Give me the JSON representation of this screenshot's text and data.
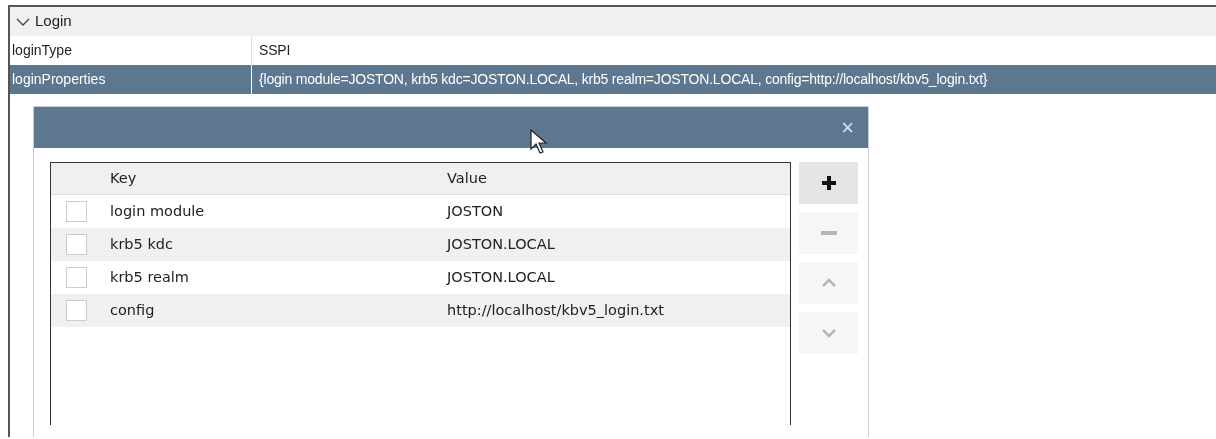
{
  "section": {
    "title": "Login",
    "expanded": true
  },
  "properties": [
    {
      "name": "loginType",
      "value": "SSPI",
      "selected": false
    },
    {
      "name": "loginProperties",
      "value": "{login module=JOSTON, krb5 kdc=JOSTON.LOCAL, krb5 realm=JOSTON.LOCAL, config=http://localhost/kbv5_login.txt}",
      "selected": true
    }
  ],
  "dialog": {
    "close": "×",
    "columns": [
      "Key",
      "Value"
    ],
    "rows": [
      {
        "key": "login module",
        "value": "JOSTON",
        "checked": false
      },
      {
        "key": "krb5 kdc",
        "value": "JOSTON.LOCAL",
        "checked": false
      },
      {
        "key": "krb5 realm",
        "value": "JOSTON.LOCAL",
        "checked": false
      },
      {
        "key": "config",
        "value": "http://localhost/kbv5_login.txt",
        "checked": false
      }
    ],
    "buttons": [
      {
        "kind": "add",
        "disabled": false
      },
      {
        "kind": "remove",
        "disabled": true
      },
      {
        "kind": "up",
        "disabled": true
      },
      {
        "kind": "down",
        "disabled": true
      }
    ]
  }
}
